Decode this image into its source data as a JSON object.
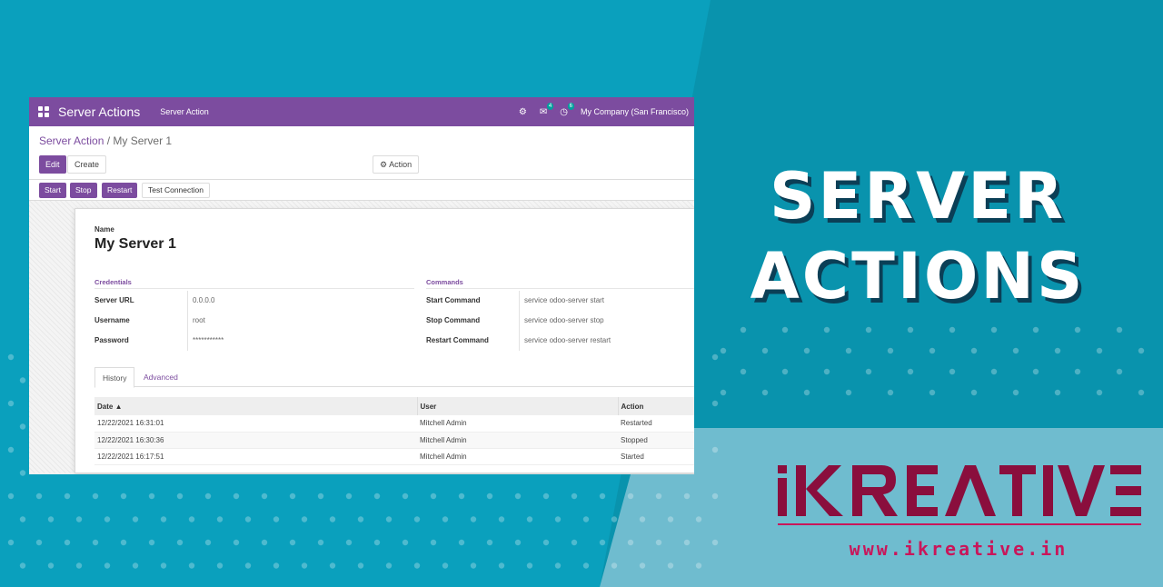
{
  "hero": {
    "line1": "SERVER",
    "line2": "ACTIONS"
  },
  "brand": {
    "logo_text": "iKREATIVE",
    "url": "www.ikreative.in"
  },
  "colors": {
    "accent": "#7c4c9f",
    "background": "#0aa0bd",
    "brand": "#c9165a",
    "brand_dark": "#8a0e3d"
  },
  "navbar": {
    "app_name": "Server Actions",
    "menu": "Server Action",
    "icons": [
      "bug-icon",
      "chat-icon",
      "clock-icon"
    ],
    "chat_badge": "4",
    "activity_badge": "6",
    "company": "My Company (San Francisco)"
  },
  "breadcrumb": {
    "parent": "Server Action",
    "separator": "/",
    "current": "My Server 1"
  },
  "control": {
    "edit": "Edit",
    "create": "Create",
    "action": "Action"
  },
  "statusbar": {
    "start": "Start",
    "stop": "Stop",
    "restart": "Restart",
    "test": "Test Connection"
  },
  "form": {
    "name_label": "Name",
    "name": "My Server 1",
    "credentials": {
      "title": "Credentials",
      "fields": [
        {
          "label": "Server URL",
          "value": "0.0.0.0"
        },
        {
          "label": "Username",
          "value": "root"
        },
        {
          "label": "Password",
          "value": "***********"
        }
      ]
    },
    "commands": {
      "title": "Commands",
      "fields": [
        {
          "label": "Start Command",
          "value": "service odoo-server start"
        },
        {
          "label": "Stop Command",
          "value": "service odoo-server stop"
        },
        {
          "label": "Restart Command",
          "value": "service odoo-server restart"
        }
      ]
    }
  },
  "tabs": {
    "history": "History",
    "advanced": "Advanced"
  },
  "history": {
    "columns": [
      "Date ▲",
      "User",
      "Action"
    ],
    "rows": [
      [
        "12/22/2021 16:31:01",
        "Mitchell Admin",
        "Restarted"
      ],
      [
        "12/22/2021 16:30:36",
        "Mitchell Admin",
        "Stopped"
      ],
      [
        "12/22/2021 16:17:51",
        "Mitchell Admin",
        "Started"
      ]
    ]
  }
}
